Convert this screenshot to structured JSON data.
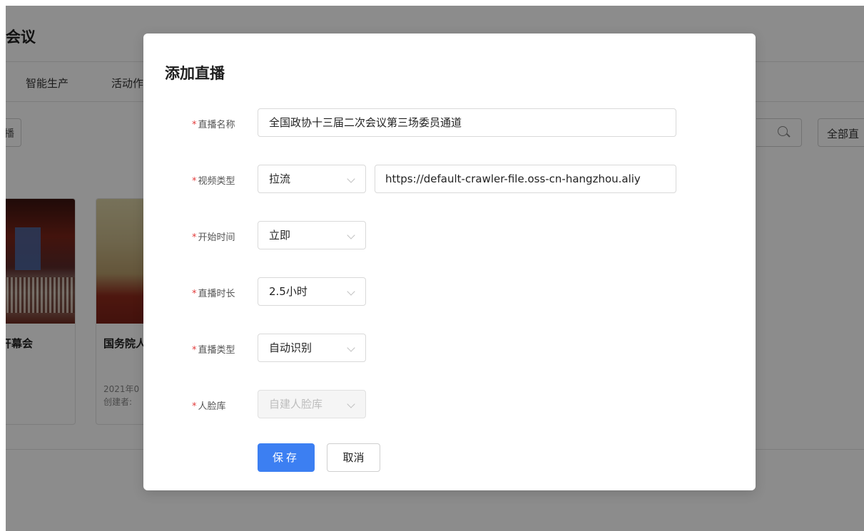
{
  "background": {
    "page_title": "会议",
    "nav_tabs": [
      "智能生产",
      "活动作"
    ],
    "left_button": "播",
    "right_button": "全部直",
    "cards": [
      {
        "title": "开幕会"
      },
      {
        "title": "国务院人",
        "date": "2021年0",
        "creator": "创建者:"
      }
    ]
  },
  "modal": {
    "title": "添加直播",
    "fields": {
      "name": {
        "label": "直播名称",
        "value": "全国政协十三届二次会议第三场委员通道"
      },
      "video_type": {
        "label": "视频类型",
        "select": "拉流",
        "url": "https://default-crawler-file.oss-cn-hangzhou.aliy"
      },
      "start_time": {
        "label": "开始时间",
        "select": "立即"
      },
      "duration": {
        "label": "直播时长",
        "select": "2.5小时"
      },
      "live_type": {
        "label": "直播类型",
        "select": "自动识别"
      },
      "face_lib": {
        "label": "人脸库",
        "select": "自建人脸库"
      }
    },
    "buttons": {
      "save": "保存",
      "cancel": "取消"
    },
    "required_mark": "*"
  },
  "colors": {
    "primary": "#3c7ff2",
    "required": "#e23b3b",
    "overlay": "rgba(0,0,0,0.45)"
  },
  "icons": {
    "search": "search-icon",
    "dropdown": "chevron-down-icon"
  }
}
